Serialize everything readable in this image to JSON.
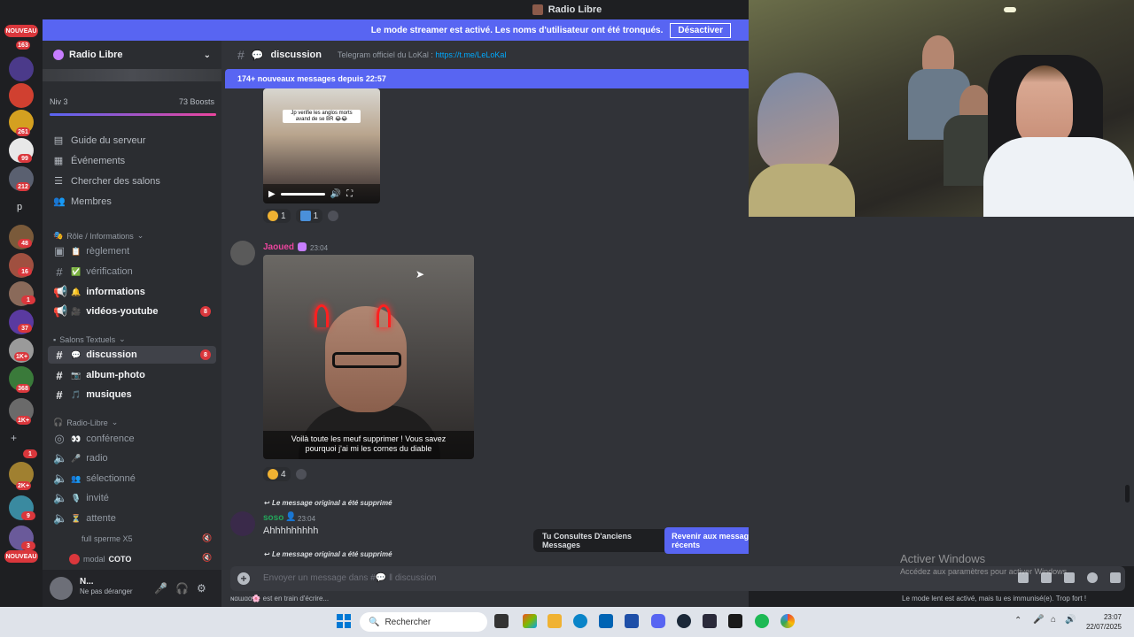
{
  "window": {
    "title": "Radio Libre"
  },
  "rail": {
    "new_label": "NOUVEAU",
    "badges": [
      "163",
      "261",
      "99",
      "212",
      "48",
      "16",
      "1",
      "37",
      "1K+",
      "368",
      "1K+",
      "1",
      "2K+",
      "9",
      "3"
    ],
    "letter": "p",
    "bottom_new_label": "NOUVEAU"
  },
  "streamer_banner": {
    "text": "Le mode streamer est activé. Les noms d'utilisateur ont été tronqués.",
    "button": "Désactiver"
  },
  "sidebar": {
    "server_name": "Radio Libre",
    "level": "Niv 3",
    "boosts": "73 Boosts",
    "boost_progress": 1.0,
    "nav": [
      "Guide du serveur",
      "Événements",
      "Chercher des salons",
      "Membres"
    ],
    "cat_roles": "Rôle / Informations",
    "channels_roles": [
      {
        "label": "règlement",
        "emoji": "📋"
      },
      {
        "label": "vérification",
        "emoji": "✅"
      },
      {
        "label": "informations",
        "emoji": "🔔"
      },
      {
        "label": "vidéos-youtube",
        "emoji": "🎥",
        "badge": "8"
      }
    ],
    "cat_text": "Salons Textuels",
    "channels_text": [
      {
        "label": "discussion",
        "emoji": "💬",
        "badge": "8"
      },
      {
        "label": "album-photo",
        "emoji": "📷"
      },
      {
        "label": "musiques",
        "emoji": "🎵"
      }
    ],
    "cat_voice": "Radio-Libre",
    "channels_voice": [
      {
        "label": "conférence",
        "emoji": "👀"
      },
      {
        "label": "radio",
        "emoji": "🎤"
      },
      {
        "label": "sélectionné",
        "emoji": "👥"
      },
      {
        "label": "invité",
        "emoji": "🎙️"
      },
      {
        "label": "attente",
        "emoji": "⏳"
      }
    ],
    "voice_users": [
      {
        "name": "full sperme X5",
        "extra": ""
      },
      {
        "name": "modal",
        "extra": "COTO"
      }
    ],
    "user": {
      "name": "N...",
      "status": "Ne pas déranger"
    }
  },
  "chat": {
    "channel": "discussion",
    "topic_prefix": "Telegram officiel du LoKal :",
    "topic_link": "https://t.me/LeLoKal",
    "new_messages": "174+ nouveaux messages depuis 22:57",
    "video1_caption": "Jp verifie les anglos morts avand de se BR 😂😂",
    "reactions1": [
      {
        "count": "1"
      },
      {
        "count": "1"
      }
    ],
    "msg2": {
      "author": "Jaoued",
      "time": "23:04",
      "caption_line1": "Voilà toute les meuf supprimer ! Vous savez",
      "caption_line2": "pourquoi j'ai mi les cornes du diable",
      "reaction_count": "4"
    },
    "reply1": "Le message original a été supprimé",
    "msg3": {
      "author": "soso",
      "time": "23:04",
      "text": "Ahhhhhhhhh"
    },
    "reply2": "Le message original a été supprimé",
    "jump_left": "Tu Consultes D'anciens Messages",
    "jump_button": "Revenir aux messages les plus récents",
    "composer_placeholder": "Envoyer un message dans #💬 ‖ discussion",
    "typing": "ɴɑɯɑɑ🌸 est en train d'écrire...",
    "slowmode": "Le mode lent est activé, mais tu es immunisé(e). Trop fort !"
  },
  "activate_windows": {
    "title": "Activer Windows",
    "subtitle": "Accédez aux paramètres pour activer Windows."
  },
  "taskbar": {
    "search": "Rechercher",
    "time": "23:07",
    "date": "22/07/2025"
  }
}
